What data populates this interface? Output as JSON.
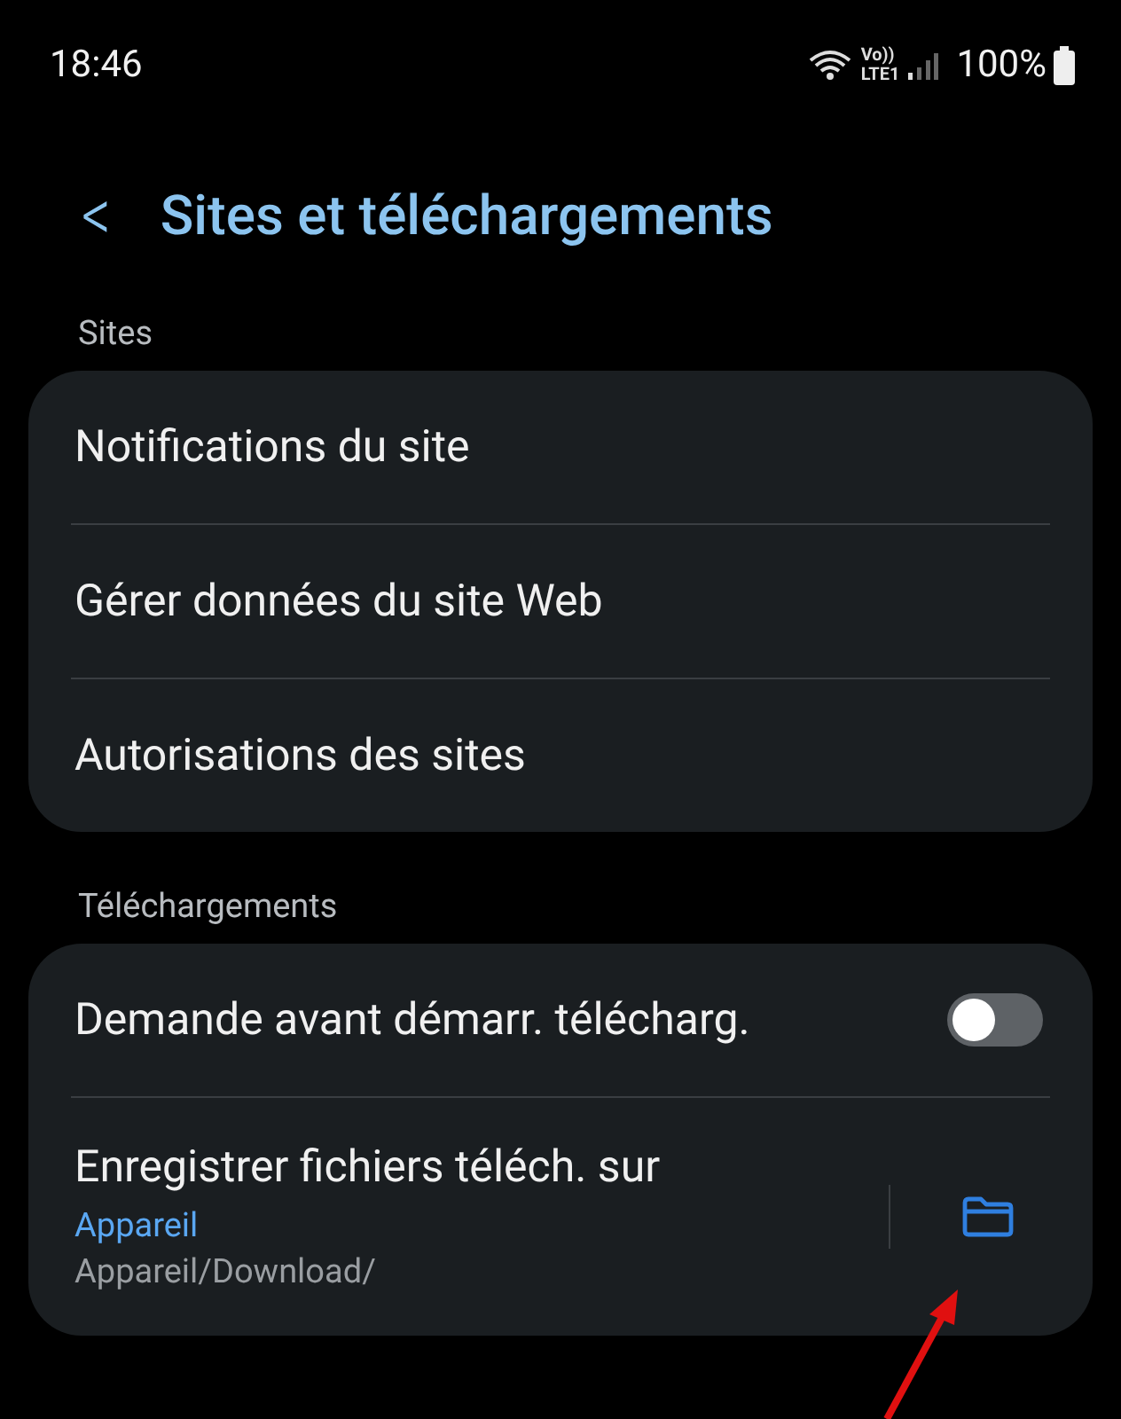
{
  "status_bar": {
    "time": "18:46",
    "network": "Vo))",
    "network_type": "LTE1",
    "battery": "100%"
  },
  "header": {
    "back": "<",
    "title": "Sites et téléchargements"
  },
  "sections": [
    {
      "title": "Sites",
      "items": [
        {
          "kind": "link",
          "label": "Notifications du site"
        },
        {
          "kind": "link",
          "label": "Gérer données du site Web"
        },
        {
          "kind": "link",
          "label": "Autorisations des sites"
        }
      ]
    },
    {
      "title": "Téléchargements",
      "items": [
        {
          "kind": "toggle",
          "label": "Demande avant démarr. télécharg.",
          "on": false
        },
        {
          "kind": "folder",
          "label": "Enregistrer fichiers téléch. sur",
          "value": "Appareil",
          "path": "Appareil/Download/"
        }
      ]
    }
  ],
  "annotation": {
    "kind": "arrow"
  }
}
